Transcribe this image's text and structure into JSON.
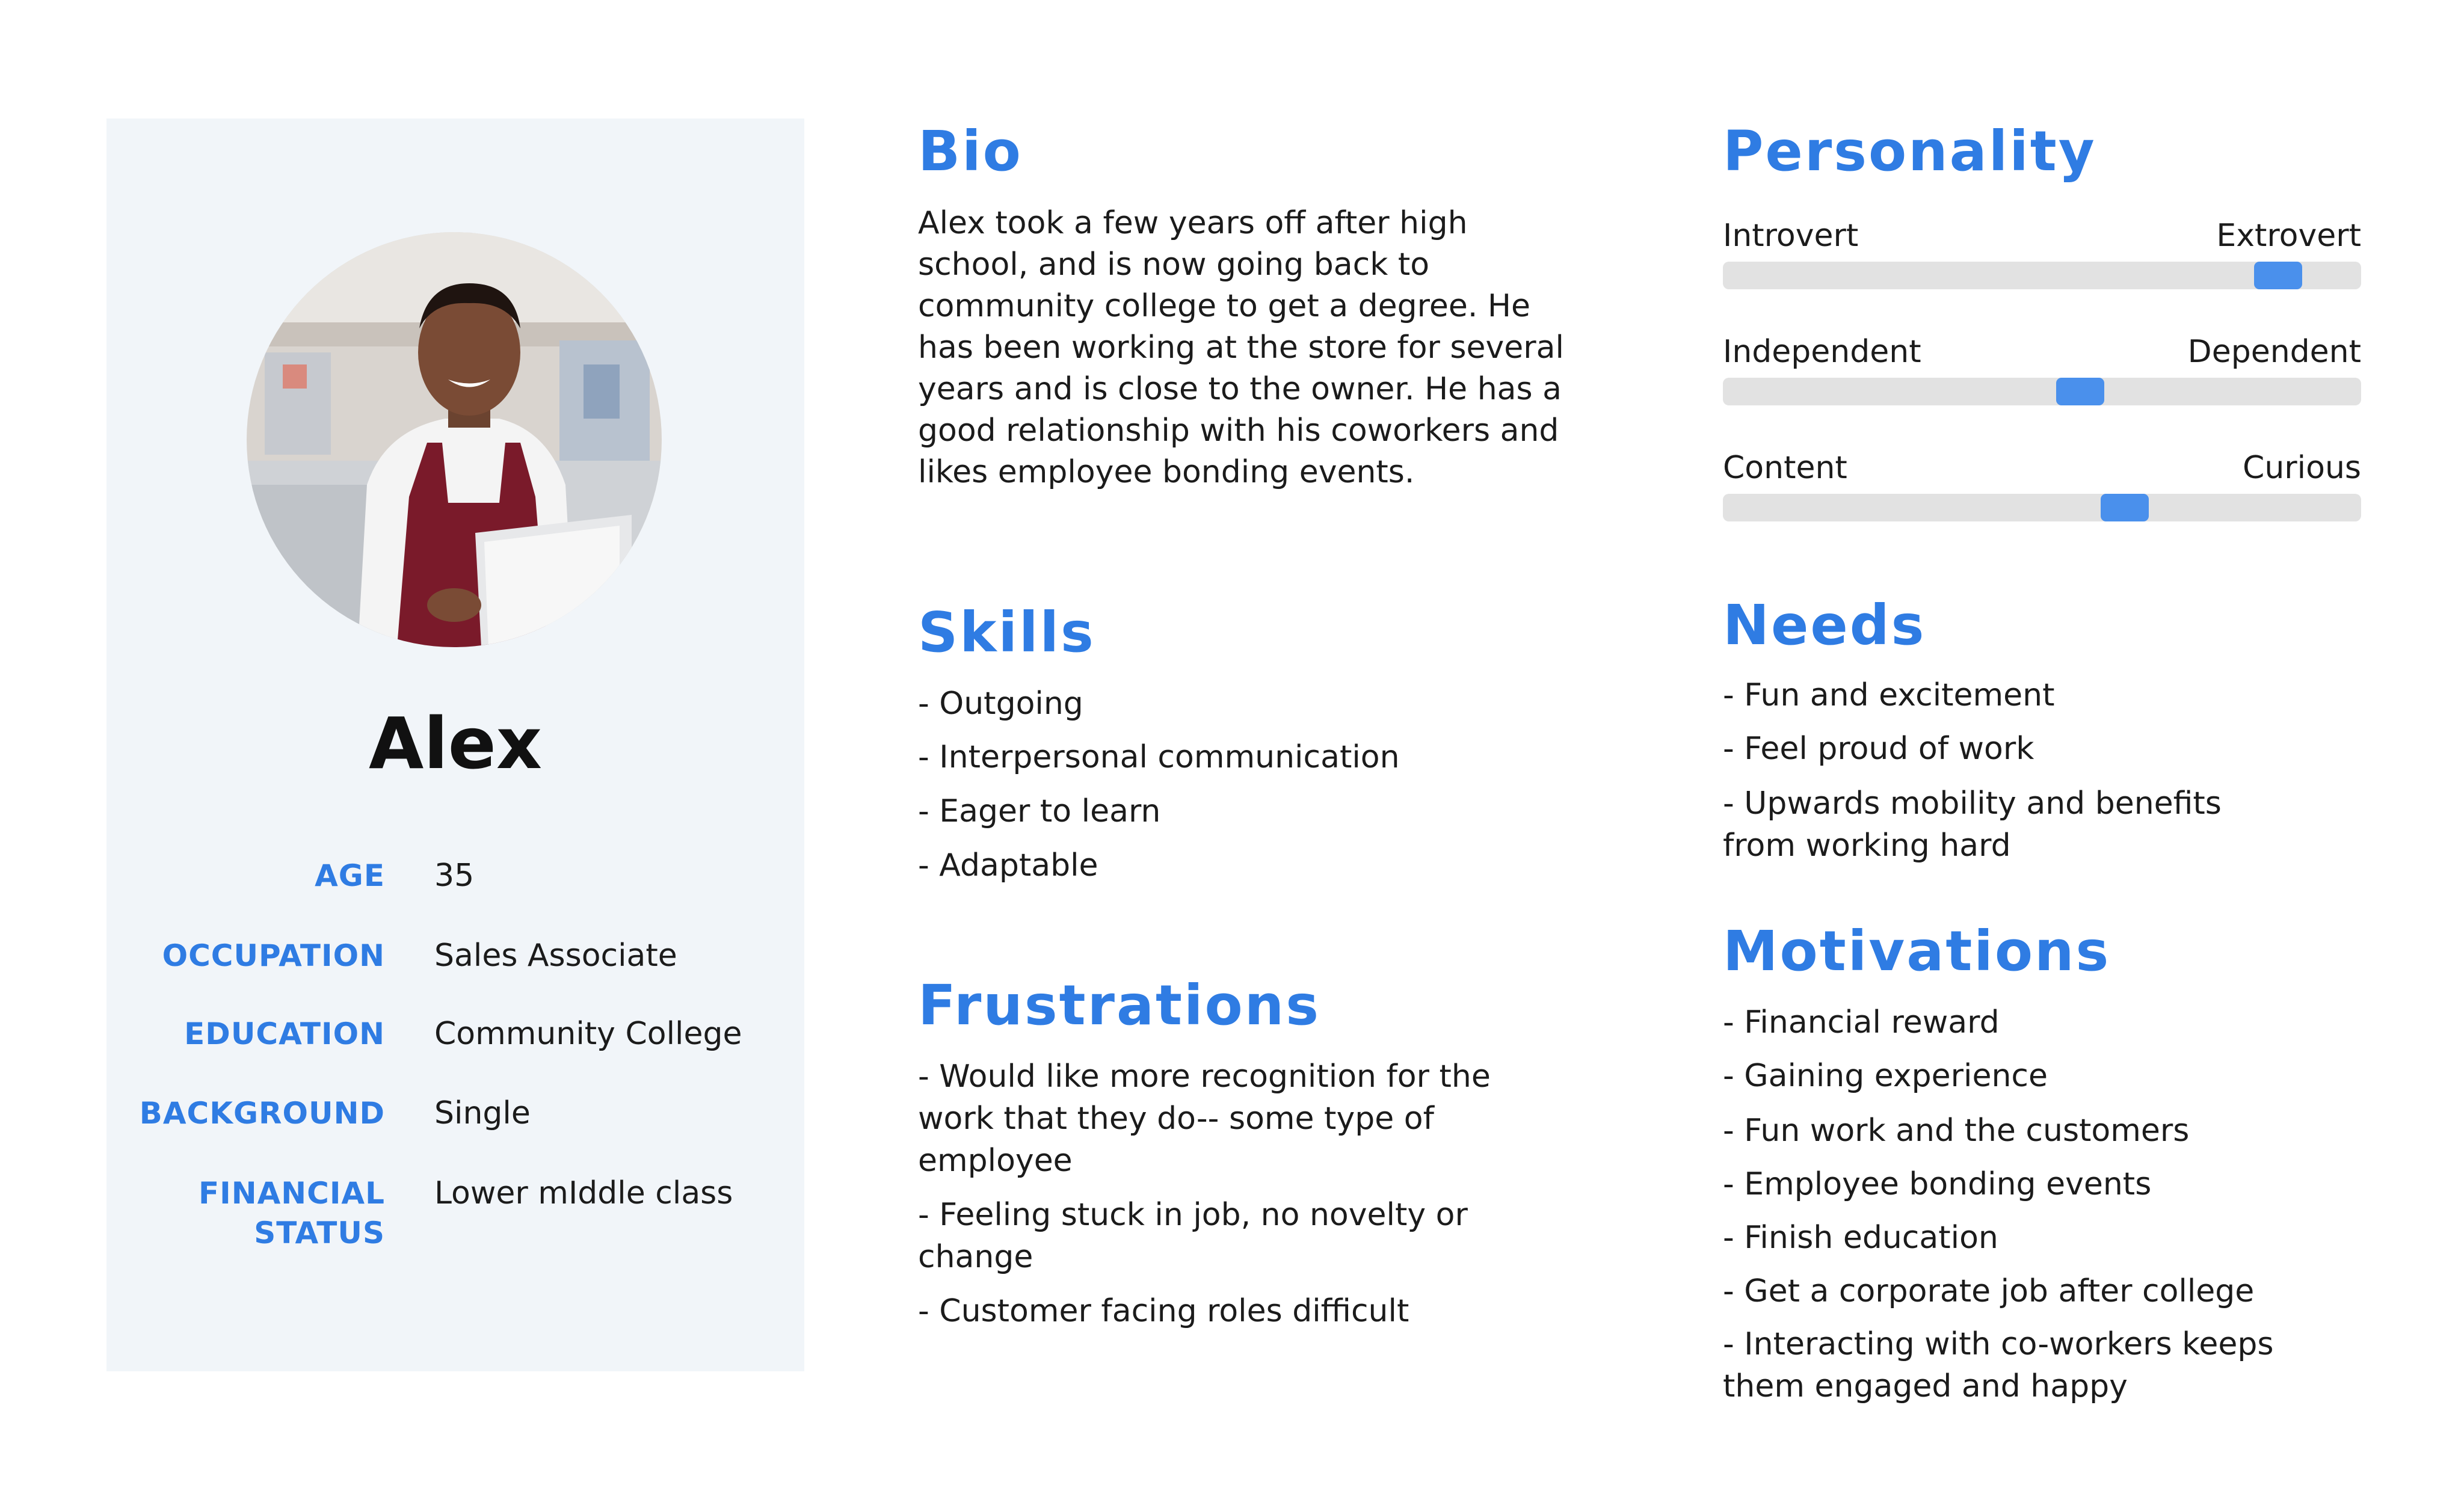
{
  "profile": {
    "name": "Alex",
    "attributes": [
      {
        "label_lines": [
          "AGE"
        ],
        "value": "35"
      },
      {
        "label_lines": [
          "OCCUPATION"
        ],
        "value": "Sales Associate"
      },
      {
        "label_lines": [
          "EDUCATION"
        ],
        "value": "Community College"
      },
      {
        "label_lines": [
          "BACKGROUND"
        ],
        "value": "Single"
      },
      {
        "label_lines": [
          "FINANCIAL",
          "STATUS"
        ],
        "value": "Lower mIddle class"
      }
    ]
  },
  "bio": {
    "title": "Bio",
    "lines": [
      "Alex took a few years off after high",
      "school, and is now going back to",
      "community college to get a degree. He",
      "has been working at the store for several",
      "years and is close to the owner. He has a",
      "good relationship with his coworkers and",
      "likes employee bonding events."
    ]
  },
  "skills": {
    "title": "Skills",
    "items": [
      "- Outgoing",
      "- Interpersonal communication",
      "- Eager to learn",
      "- Adaptable"
    ]
  },
  "frustrations": {
    "title": "Frustrations",
    "items": [
      [
        "- Would like more recognition for the",
        "work that they do-- some type of",
        "employee"
      ],
      [
        "- Feeling stuck in job, no novelty or",
        "change"
      ],
      [
        "- Customer facing roles difficult"
      ]
    ]
  },
  "personality": {
    "title": "Personality",
    "traits": [
      {
        "left": "Introvert",
        "right": "Extrovert",
        "level": 0.87
      },
      {
        "left": "Independent",
        "right": "Dependent",
        "level": 0.56
      },
      {
        "left": "Content",
        "right": "Curious",
        "level": 0.63
      }
    ]
  },
  "needs": {
    "title": "Needs",
    "items": [
      [
        "- Fun and excitement"
      ],
      [
        "- Feel proud of work"
      ],
      [
        "- Upwards mobility and benefits",
        "from working hard"
      ]
    ]
  },
  "motivations": {
    "title": "Motivations",
    "items": [
      [
        "- Financial reward"
      ],
      [
        "- Gaining experience"
      ],
      [
        "- Fun work and the customers"
      ],
      [
        "- Employee bonding events"
      ],
      [
        "- Finish education"
      ],
      [
        "- Get a corporate job after college"
      ],
      [
        "- Interacting with co-workers keeps",
        "them engaged and happy"
      ]
    ]
  },
  "colors": {
    "accent": "#2f7ce3",
    "card_bg": "#f1f5f9",
    "slider_track": "#e2e2e2",
    "slider_thumb": "#4a90ec",
    "apron": "#7a1a2a"
  }
}
